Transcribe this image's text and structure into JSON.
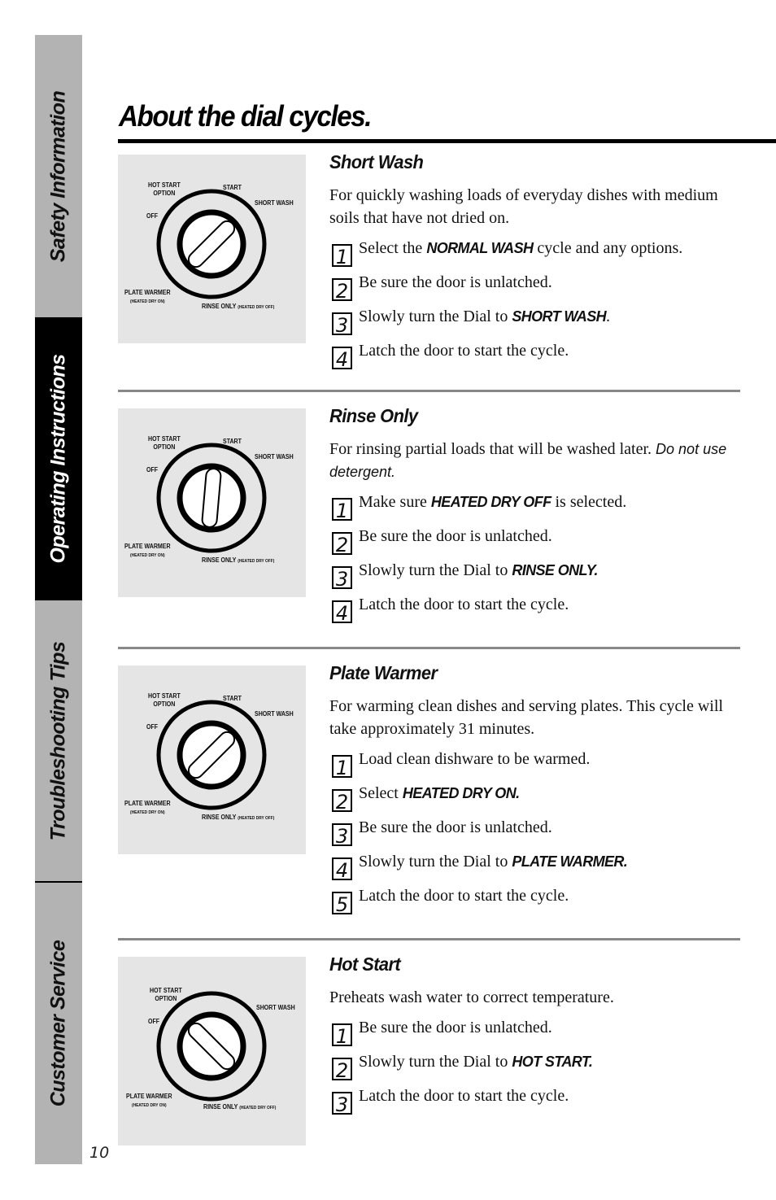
{
  "sidebar": {
    "tabs": [
      {
        "label": "Safety Information",
        "active": false
      },
      {
        "label": "Operating Instructions",
        "active": true
      },
      {
        "label": "Troubleshooting Tips",
        "active": false
      },
      {
        "label": "Customer Service",
        "active": false
      }
    ]
  },
  "page": {
    "title": "About the dial cycles.",
    "number": "10"
  },
  "dial_labels": {
    "hot_start_option": "HOT START\nOPTION",
    "hot_start_line1": "HOT START",
    "hot_start_line2": "OPTION",
    "start": "START",
    "short_wash": "SHORT WASH",
    "off": "OFF",
    "plate_warmer": "PLATE WARMER",
    "heated_dry_on": "(HEATED DRY ON)",
    "rinse_only": "RINSE ONLY",
    "heated_dry_off": "(HEATED DRY OFF)"
  },
  "sections": [
    {
      "heading": "Short Wash",
      "dial_position": "SHORT WASH",
      "description": "For quickly washing loads of everyday dishes with medium soils that have not dried on.",
      "steps": [
        {
          "num": "1",
          "before": "Select the ",
          "keyword": "NORMAL WASH",
          "after": " cycle and any options."
        },
        {
          "num": "2",
          "before": "Be sure the door is unlatched.",
          "keyword": "",
          "after": ""
        },
        {
          "num": "3",
          "before": "Slowly turn the Dial to ",
          "keyword": "SHORT WASH",
          "after": "."
        },
        {
          "num": "4",
          "before": "Latch the door to start the cycle.",
          "keyword": "",
          "after": ""
        }
      ]
    },
    {
      "heading": "Rinse Only",
      "dial_position": "RINSE ONLY",
      "description": "For rinsing partial loads that will be washed later. ",
      "description_emphasis": "Do not use detergent.",
      "steps": [
        {
          "num": "1",
          "before": "Make sure ",
          "keyword": "HEATED DRY OFF",
          "after": " is selected."
        },
        {
          "num": "2",
          "before": "Be sure the door is unlatched.",
          "keyword": "",
          "after": ""
        },
        {
          "num": "3",
          "before": "Slowly turn the Dial to ",
          "keyword": "RINSE ONLY.",
          "after": ""
        },
        {
          "num": "4",
          "before": "Latch the door to start the cycle.",
          "keyword": "",
          "after": ""
        }
      ]
    },
    {
      "heading": "Plate Warmer",
      "dial_position": "PLATE WARMER",
      "description": "For warming clean dishes and serving plates. This cycle will take approximately 31 minutes.",
      "steps": [
        {
          "num": "1",
          "before": "Load clean dishware to be warmed.",
          "keyword": "",
          "after": ""
        },
        {
          "num": "2",
          "before": "Select ",
          "keyword": "HEATED DRY ON.",
          "after": ""
        },
        {
          "num": "3",
          "before": "Be sure the door is unlatched.",
          "keyword": "",
          "after": ""
        },
        {
          "num": "4",
          "before": "Slowly turn the Dial to ",
          "keyword": "PLATE WARMER.",
          "after": ""
        },
        {
          "num": "5",
          "before": "Latch the door to start the cycle.",
          "keyword": "",
          "after": ""
        }
      ]
    },
    {
      "heading": "Hot Start",
      "dial_position": "HOT START",
      "description": "Preheats wash water to correct temperature.",
      "steps": [
        {
          "num": "1",
          "before": "Be sure the door is unlatched.",
          "keyword": "",
          "after": ""
        },
        {
          "num": "2",
          "before": "Slowly turn the Dial to ",
          "keyword": "HOT START.",
          "after": ""
        },
        {
          "num": "3",
          "before": "Latch the door to start the cycle.",
          "keyword": "",
          "after": ""
        }
      ]
    }
  ]
}
